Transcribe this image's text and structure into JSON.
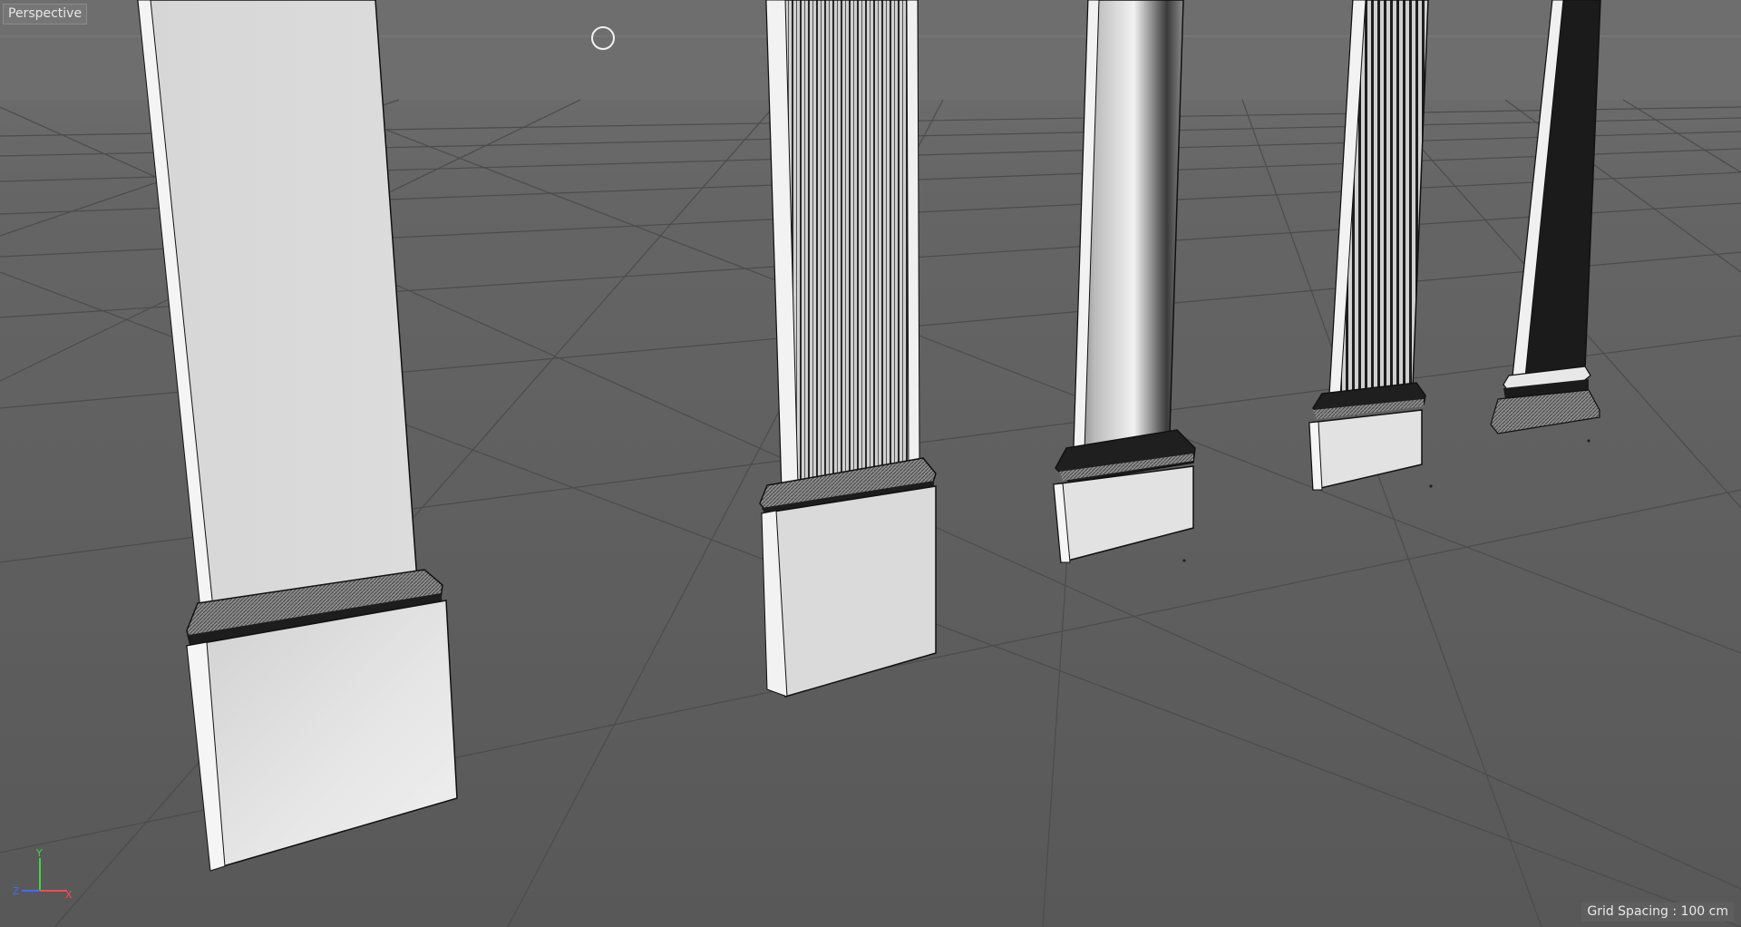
{
  "viewport": {
    "view_name": "Perspective",
    "grid_spacing_label": "Grid Spacing : 100 cm"
  },
  "axis_gizmo": {
    "y_label": "Y",
    "z_label": "Z",
    "x_label": "X",
    "y_color": "#3fd63f",
    "z_color": "#3f6cff",
    "x_color": "#ff4b4b"
  },
  "colors": {
    "floor_top": "#636363",
    "floor_bottom": "#585858",
    "grid_line": "#4a4a4a",
    "object_light": "#e4e4e4",
    "object_mid": "#cfcfcf",
    "object_dark": "#1b1b1b"
  }
}
